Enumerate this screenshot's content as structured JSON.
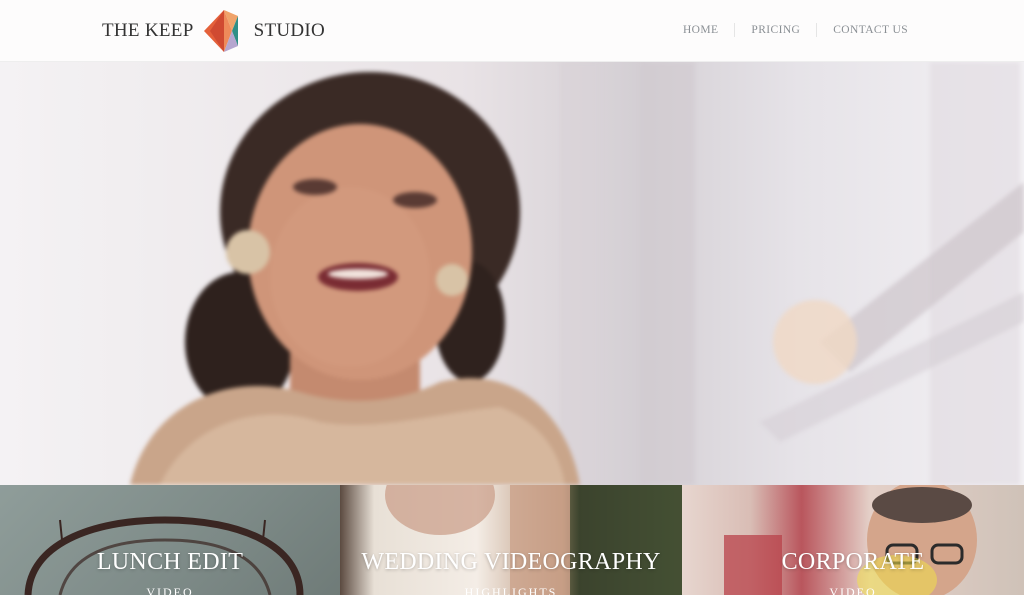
{
  "brand": {
    "left_text": "THE KEEP",
    "right_text": "STUDIO",
    "logo_icon": "geometric-diamond-logo",
    "logo_colors": [
      "#e4603a",
      "#c94430",
      "#f0a36a",
      "#2f8f86",
      "#b5a6cf"
    ]
  },
  "nav": {
    "items": [
      "HOME",
      "PRICING",
      "CONTACT US"
    ]
  },
  "tiles": [
    {
      "title": "LUNCH EDIT",
      "subtitle": "VIDEO"
    },
    {
      "title": "WEDDING VIDEOGRAPHY",
      "subtitle": "HIGHLIGHTS"
    },
    {
      "title": "CORPORATE",
      "subtitle": "VIDEO"
    }
  ]
}
